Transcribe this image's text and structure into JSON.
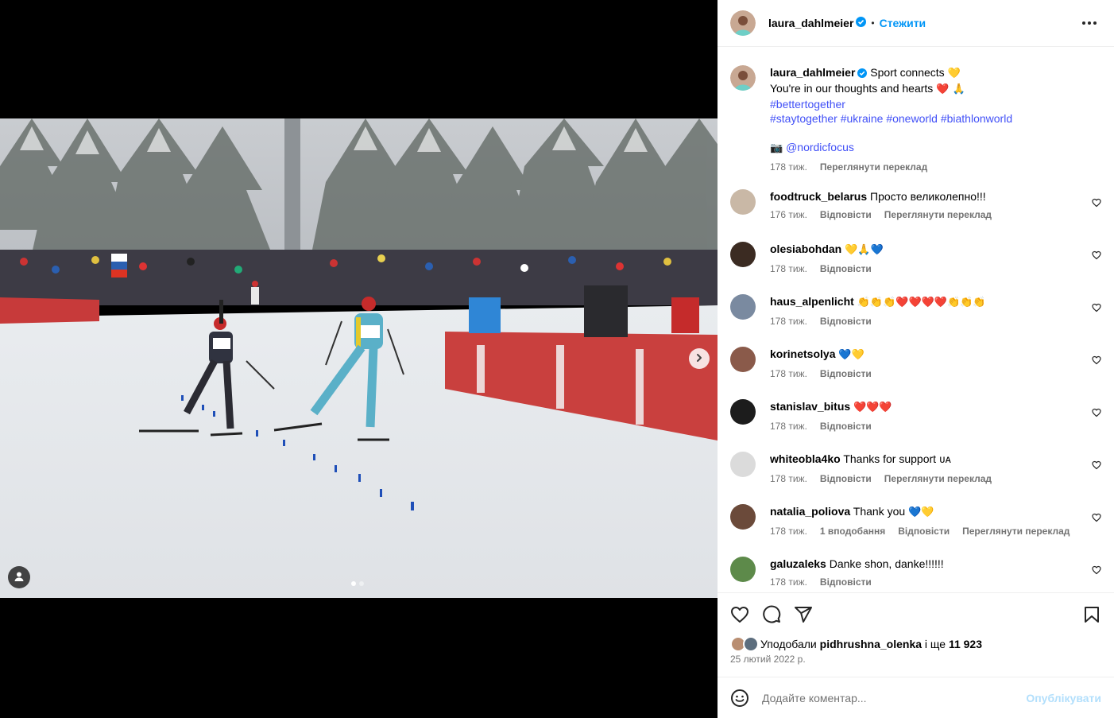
{
  "post": {
    "author": "laura_dahlmeier",
    "follow_label": "Стежити",
    "separator": "•",
    "caption": {
      "text_line1": "Sport connects",
      "emoji_line1": "💛",
      "text_line2": "You're in our thoughts and hearts",
      "emoji_line2": "❤️ 🙏",
      "hashtag_1": "#bettertogether",
      "hashtags_line": [
        "#staytogether",
        "#ukraine",
        "#oneworld",
        "#biathlonworld"
      ],
      "camera_emoji": "📷",
      "mention": "@nordicfocus",
      "time": "178 тиж.",
      "translate": "Переглянути переклад"
    },
    "comments": [
      {
        "user": "foodtruck_belarus",
        "text": "Просто великолепно!!!",
        "emoji": "",
        "time": "176 тиж.",
        "reply": "Відповісти",
        "translate": "Переглянути переклад",
        "likes": "",
        "avatar_color": "#c9b8a6"
      },
      {
        "user": "olesiabohdan",
        "text": "",
        "emoji": "💛🙏💙",
        "time": "178 тиж.",
        "reply": "Відповісти",
        "translate": "",
        "likes": "",
        "avatar_color": "#3b2b22"
      },
      {
        "user": "haus_alpenlicht",
        "text": "",
        "emoji": "👏👏👏❤️❤️❤️❤️👏👏👏",
        "time": "178 тиж.",
        "reply": "Відповісти",
        "translate": "",
        "likes": "",
        "avatar_color": "#7a8aa0"
      },
      {
        "user": "korinetsolya",
        "text": "",
        "emoji": "💙💛",
        "time": "178 тиж.",
        "reply": "Відповісти",
        "translate": "",
        "likes": "",
        "avatar_color": "#8a5a4a"
      },
      {
        "user": "stanislav_bitus",
        "text": "",
        "emoji": "❤️❤️❤️",
        "time": "178 тиж.",
        "reply": "Відповісти",
        "translate": "",
        "likes": "",
        "avatar_color": "#1c1c1c"
      },
      {
        "user": "whiteobla4ko",
        "text": "Thanks for support",
        "emoji": "ᴜᴀ",
        "time": "178 тиж.",
        "reply": "Відповісти",
        "translate": "Переглянути переклад",
        "likes": "",
        "avatar_color": "#dbdbdb"
      },
      {
        "user": "natalia_poliova",
        "text": "Thank you",
        "emoji": "💙💛",
        "time": "178 тиж.",
        "reply": "Відповісти",
        "translate": "Переглянути переклад",
        "likes": "1 вподобання",
        "avatar_color": "#6b4a3a"
      },
      {
        "user": "galuzaleks",
        "text": "Danke shon, danke!!!!!!",
        "emoji": "",
        "time": "178 тиж.",
        "reply": "Відповісти",
        "translate": "",
        "likes": "",
        "avatar_color": "#5d8a4a"
      }
    ],
    "likes": {
      "prefix": "Уподобали",
      "user": "pidhrushna_olenka",
      "middle": "і ще",
      "count": "11 923"
    },
    "date": "25 лютий 2022 р.",
    "comment_input": {
      "placeholder": "Додайте коментар...",
      "publish": "Опублікувати"
    },
    "carousel": {
      "slides": 2,
      "current": 1
    }
  },
  "colors": {
    "link": "#4150f7",
    "follow": "#0095f6",
    "muted": "#737373",
    "publish_disabled": "#b2dffc"
  }
}
